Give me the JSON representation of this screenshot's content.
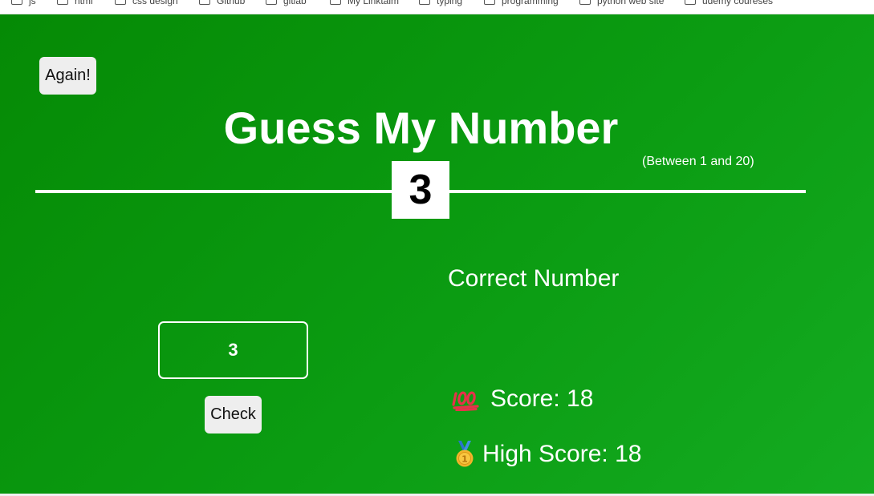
{
  "bookmarks": [
    {
      "label": "js"
    },
    {
      "label": "html"
    },
    {
      "label": "css design"
    },
    {
      "label": "Github"
    },
    {
      "label": "gitlab"
    },
    {
      "label": "My Linktaim"
    },
    {
      "label": "typing"
    },
    {
      "label": "programming"
    },
    {
      "label": "python web site"
    },
    {
      "label": "udemy coureses"
    }
  ],
  "game": {
    "again_label": "Again!",
    "title": "Guess My Number",
    "range_hint": "(Between 1 and 20)",
    "secret_number": "3",
    "guess_value": "3",
    "check_label": "Check",
    "message": "Correct Number",
    "score_label": "Score: 18",
    "highscore_label": "High Score: 18",
    "score_icon": "hundred-points-icon",
    "highscore_icon": "medal-icon",
    "background_color": "#0b9c12"
  }
}
